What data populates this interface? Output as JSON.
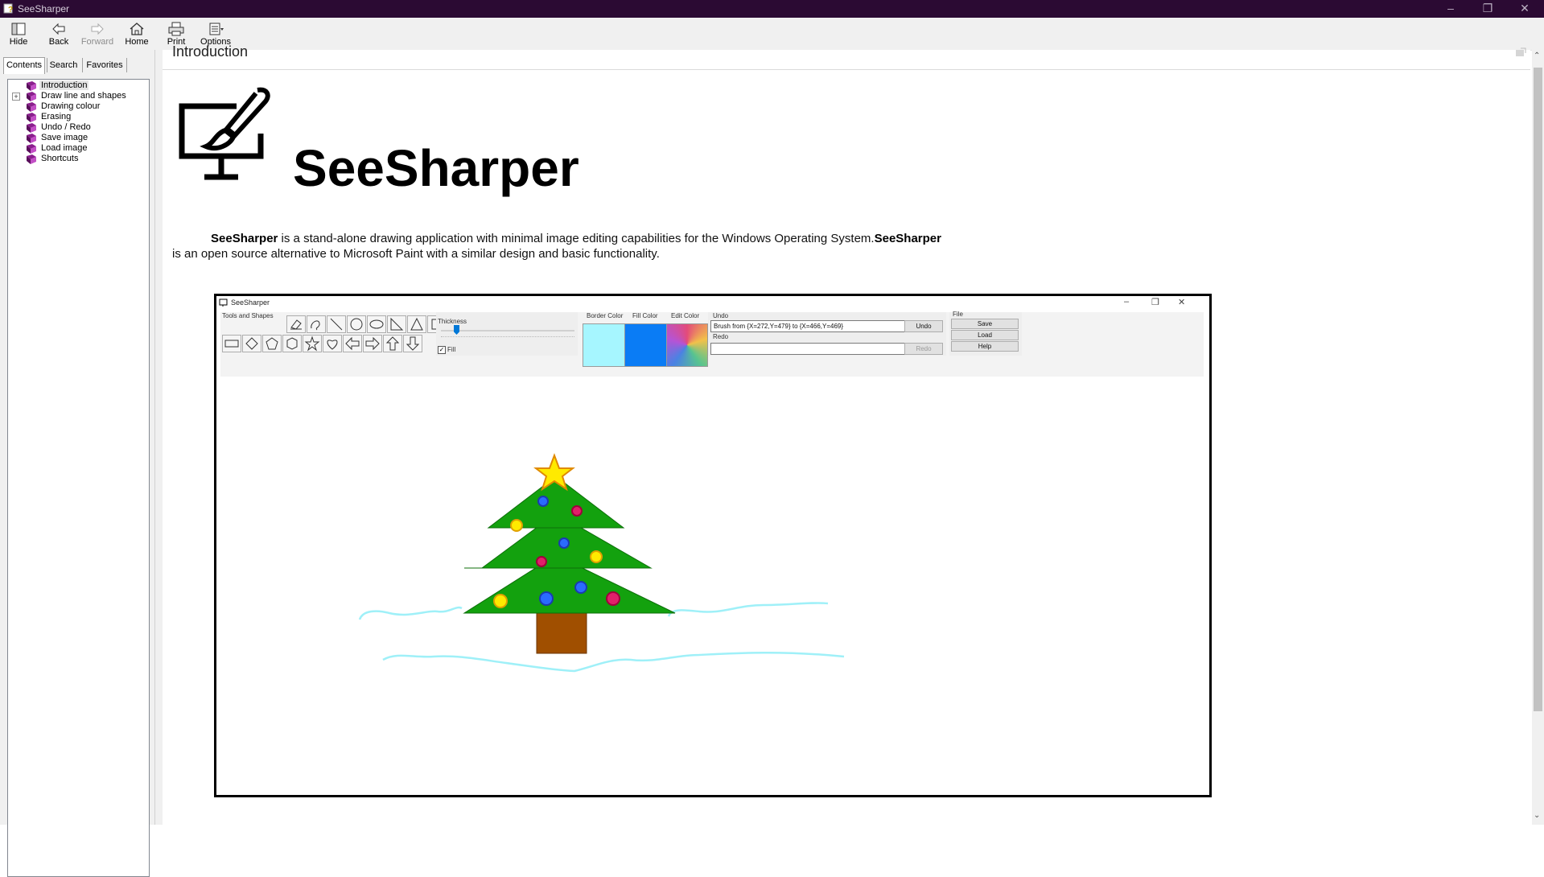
{
  "window": {
    "title": "SeeSharper"
  },
  "toolbar": {
    "hide": "Hide",
    "back": "Back",
    "forward": "Forward",
    "home": "Home",
    "print": "Print",
    "options": "Options"
  },
  "tabs": {
    "contents": "Contents",
    "search": "Search",
    "favorites": "Favorites"
  },
  "tree": {
    "items": [
      {
        "label": "Introduction",
        "selected": true
      },
      {
        "label": "Draw line and shapes",
        "expandable": true
      },
      {
        "label": "Drawing colour"
      },
      {
        "label": "Erasing"
      },
      {
        "label": "Undo / Redo"
      },
      {
        "label": "Save image"
      },
      {
        "label": "Load image"
      },
      {
        "label": "Shortcuts"
      }
    ],
    "expander_glyph": "+"
  },
  "page": {
    "heading": "Introduction",
    "brand": "SeeSharper",
    "desc": {
      "b1": "SeeSharper",
      "t1": " is a stand-alone drawing application with minimal image editing capabilities for the Windows Operating System.",
      "b2": "SeeSharper",
      "t2": "is an open source alternative to Microsoft Paint with a similar design and basic functionality."
    }
  },
  "screenshot": {
    "title": "SeeSharper",
    "tools_label": "Tools and Shapes",
    "thickness_label": "Thickness",
    "fill_label": "Fill",
    "border_color_label": "Border Color",
    "fill_color_label": "Fill Color",
    "edit_color_label": "Edit Color",
    "undo_label": "Undo",
    "undo_text": "Brush from {X=272,Y=479} to {X=466,Y=469}",
    "undo_button": "Undo",
    "redo_label": "Redo",
    "redo_button": "Redo",
    "file_label": "File",
    "save_button": "Save",
    "load_button": "Load",
    "help_button": "Help",
    "colors": {
      "border": "#a6f6ff",
      "fill": "#0a7cf5"
    }
  },
  "colors": {
    "titlebar": "#2b0a33",
    "tree_book": "#8b1e8e",
    "tree_green": "#13a10e",
    "trunk": "#a04f00",
    "star": "#ffea00",
    "snow": "#9ff0f8"
  }
}
